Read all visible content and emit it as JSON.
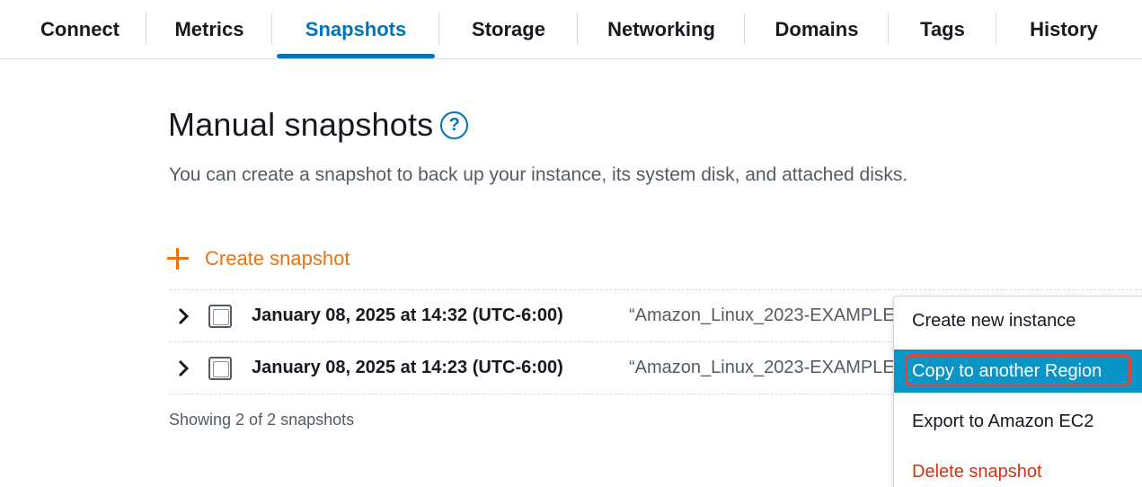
{
  "tabs": [
    {
      "label": "Connect",
      "active": false
    },
    {
      "label": "Metrics",
      "active": false
    },
    {
      "label": "Snapshots",
      "active": true
    },
    {
      "label": "Storage",
      "active": false
    },
    {
      "label": "Networking",
      "active": false
    },
    {
      "label": "Domains",
      "active": false
    },
    {
      "label": "Tags",
      "active": false
    },
    {
      "label": "History",
      "active": false
    }
  ],
  "section": {
    "title": "Manual snapshots",
    "help_icon": "?",
    "description": "You can create a snapshot to back up your instance, its system disk, and attached disks."
  },
  "create_button": {
    "label": "Create snapshot",
    "icon": "plus-icon"
  },
  "snapshots": [
    {
      "date": "January 08, 2025 at 14:32 (UTC-6:00)",
      "name": "“Amazon_Linux_2023-EXAMPLE"
    },
    {
      "date": "January 08, 2025 at 14:23 (UTC-6:00)",
      "name": "“Amazon_Linux_2023-EXAMPLE"
    }
  ],
  "footer": "Showing 2 of 2 snapshots",
  "context_menu": {
    "items": [
      {
        "label": "Create new instance",
        "state": "normal"
      },
      {
        "label": "Copy to another Region",
        "state": "highlighted"
      },
      {
        "label": "Export to Amazon EC2",
        "state": "normal"
      },
      {
        "label": "Delete snapshot",
        "state": "danger"
      }
    ]
  },
  "colors": {
    "accent": "#0073bb",
    "create": "#ec7211",
    "highlight_bg": "#0a95c7",
    "highlight_ring": "#e0453b",
    "danger": "#d13212"
  }
}
